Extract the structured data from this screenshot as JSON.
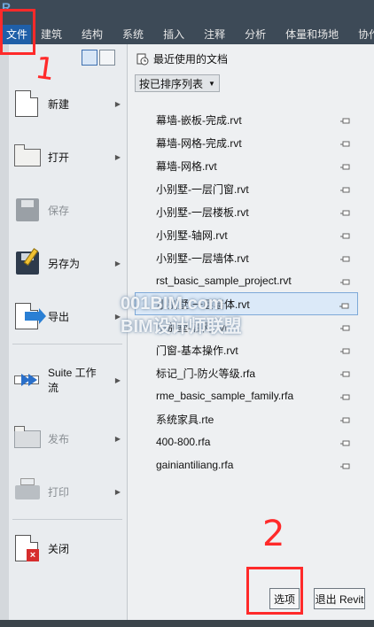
{
  "app": {
    "logo_letter": "R"
  },
  "ribbon": {
    "tabs": [
      "文件",
      "建筑",
      "结构",
      "系统",
      "插入",
      "注释",
      "分析",
      "体量和场地",
      "协作"
    ]
  },
  "menu": {
    "items": [
      {
        "label": "新建",
        "has_submenu": true,
        "enabled": true,
        "icon": "new-document-icon"
      },
      {
        "label": "打开",
        "has_submenu": true,
        "enabled": true,
        "icon": "open-folder-icon"
      },
      {
        "label": "保存",
        "has_submenu": false,
        "enabled": false,
        "icon": "save-disk-icon"
      },
      {
        "label": "另存为",
        "has_submenu": true,
        "enabled": true,
        "icon": "save-as-icon"
      },
      {
        "label": "导出",
        "has_submenu": true,
        "enabled": true,
        "icon": "export-icon"
      },
      {
        "label": "Suite 工作流",
        "has_submenu": true,
        "enabled": true,
        "icon": "suite-workflow-icon"
      },
      {
        "label": "发布",
        "has_submenu": true,
        "enabled": false,
        "icon": "publish-icon"
      },
      {
        "label": "打印",
        "has_submenu": true,
        "enabled": false,
        "icon": "print-icon"
      },
      {
        "label": "关闭",
        "has_submenu": false,
        "enabled": true,
        "icon": "close-document-icon"
      }
    ]
  },
  "recent": {
    "title": "最近使用的文档",
    "sort_label": "按已排序列表",
    "documents": [
      "幕墙-嵌板-完成.rvt",
      "幕墙-网格-完成.rvt",
      "幕墙-网格.rvt",
      "小别墅-一层门窗.rvt",
      "小别墅-一层楼板.rvt",
      "小别墅-轴网.rvt",
      "小别墅-一层墙体.rvt",
      "rst_basic_sample_project.rvt",
      "小别墅-一层墙体.rvt",
      "小别墅-轴网.rvt",
      "门窗-基本操作.rvt",
      "标记_门-防火等级.rfa",
      "rme_basic_sample_family.rfa",
      "系统家具.rte",
      "400-800.rfa",
      "gainiantiliang.rfa"
    ],
    "highlighted_index": 8
  },
  "footer": {
    "options_label": "选项",
    "exit_label": "退出 Revit"
  },
  "annotations": {
    "step1": "1",
    "step2": "2"
  },
  "watermark": {
    "line1": "001BIM.com",
    "line2": "BIM设计师联盟"
  },
  "colors": {
    "annotation": "#ff2a2a",
    "file_tab": "#1f5fa8",
    "highlight": "#dbe9f8"
  }
}
